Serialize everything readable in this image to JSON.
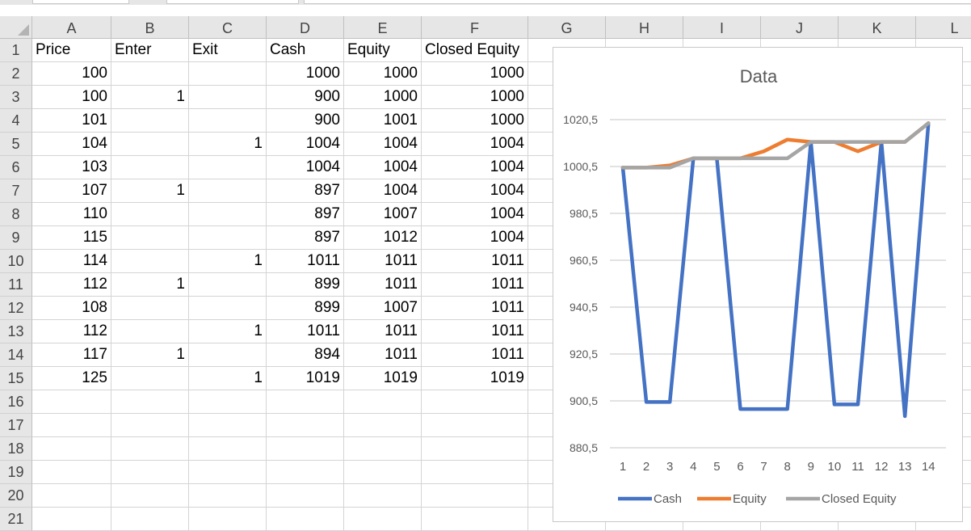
{
  "columns": [
    "A",
    "B",
    "C",
    "D",
    "E",
    "F",
    "G",
    "H",
    "I",
    "J",
    "K",
    "L"
  ],
  "rows": [
    "1",
    "2",
    "3",
    "4",
    "5",
    "6",
    "7",
    "8",
    "9",
    "10",
    "11",
    "12",
    "13",
    "14",
    "15",
    "16",
    "17",
    "18",
    "19",
    "20",
    "21"
  ],
  "headers": [
    "Price",
    "Enter",
    "Exit",
    "Cash",
    "Equity",
    "Closed Equity"
  ],
  "table": [
    [
      "100",
      "",
      "",
      "1000",
      "1000",
      "1000"
    ],
    [
      "100",
      "1",
      "",
      "900",
      "1000",
      "1000"
    ],
    [
      "101",
      "",
      "",
      "900",
      "1001",
      "1000"
    ],
    [
      "104",
      "",
      "1",
      "1004",
      "1004",
      "1004"
    ],
    [
      "103",
      "",
      "",
      "1004",
      "1004",
      "1004"
    ],
    [
      "107",
      "1",
      "",
      "897",
      "1004",
      "1004"
    ],
    [
      "110",
      "",
      "",
      "897",
      "1007",
      "1004"
    ],
    [
      "115",
      "",
      "",
      "897",
      "1012",
      "1004"
    ],
    [
      "114",
      "",
      "1",
      "1011",
      "1011",
      "1011"
    ],
    [
      "112",
      "1",
      "",
      "899",
      "1011",
      "1011"
    ],
    [
      "108",
      "",
      "",
      "899",
      "1007",
      "1011"
    ],
    [
      "112",
      "",
      "1",
      "1011",
      "1011",
      "1011"
    ],
    [
      "117",
      "1",
      "",
      "894",
      "1011",
      "1011"
    ],
    [
      "125",
      "",
      "1",
      "1019",
      "1019",
      "1019"
    ]
  ],
  "chart_data": {
    "type": "line",
    "title": "Data",
    "x": [
      1,
      2,
      3,
      4,
      5,
      6,
      7,
      8,
      9,
      10,
      11,
      12,
      13,
      14
    ],
    "ylim": [
      880.5,
      1030.5
    ],
    "yticks": [
      880.5,
      900.5,
      920.5,
      940.5,
      960.5,
      980.5,
      1000.5,
      1020.5
    ],
    "ytick_labels": [
      "880,5",
      "900,5",
      "920,5",
      "940,5",
      "960,5",
      "980,5",
      "1000,5",
      "1020,5"
    ],
    "grid": true,
    "legend": "bottom",
    "series": [
      {
        "name": "Cash",
        "color": "#4472c4",
        "values": [
          1000,
          900,
          900,
          1004,
          1004,
          897,
          897,
          897,
          1011,
          899,
          899,
          1011,
          894,
          1019
        ]
      },
      {
        "name": "Equity",
        "color": "#ed7d31",
        "values": [
          1000,
          1000,
          1001,
          1004,
          1004,
          1004,
          1007,
          1012,
          1011,
          1011,
          1007,
          1011,
          1011,
          1019
        ]
      },
      {
        "name": "Closed Equity",
        "color": "#a5a5a5",
        "values": [
          1000,
          1000,
          1000,
          1004,
          1004,
          1004,
          1004,
          1004,
          1011,
          1011,
          1011,
          1011,
          1011,
          1019
        ]
      }
    ]
  }
}
